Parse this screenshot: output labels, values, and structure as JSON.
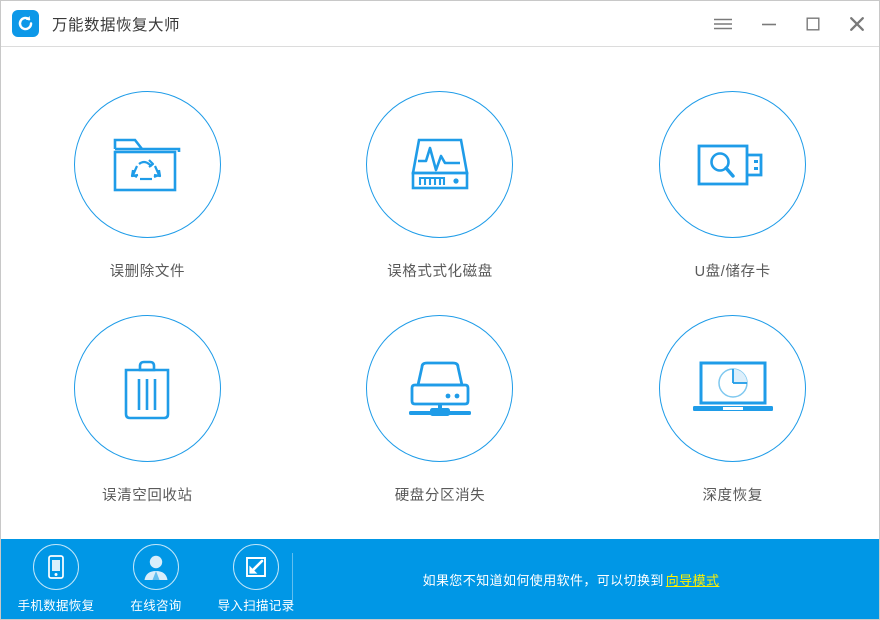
{
  "window": {
    "title": "万能数据恢复大师",
    "logo_icon": "refresh-circle-logo-icon",
    "accent_color": "#1f9ce8",
    "bottom_bar_color": "#0097e6",
    "controls": [
      {
        "name": "menu-button",
        "icon": "hamburger-menu-icon",
        "label": ""
      },
      {
        "name": "minimize-button",
        "icon": "minimize-icon",
        "label": ""
      },
      {
        "name": "maximize-button",
        "icon": "maximize-icon",
        "label": ""
      },
      {
        "name": "close-button",
        "icon": "close-icon",
        "label": ""
      }
    ]
  },
  "main": {
    "cards": [
      {
        "label": "误删除文件",
        "icon": "folder-recycle-icon"
      },
      {
        "label": "误格式式化磁盘",
        "icon": "disk-pulse-icon"
      },
      {
        "label": "U盘/储存卡",
        "icon": "usb-search-icon"
      },
      {
        "label": "误清空回收站",
        "icon": "trash-bin-icon"
      },
      {
        "label": "硬盘分区消失",
        "icon": "external-drive-icon"
      },
      {
        "label": "深度恢复",
        "icon": "laptop-pie-icon"
      }
    ]
  },
  "bottom": {
    "actions": [
      {
        "label": "手机数据恢复",
        "icon": "mobile-phone-icon"
      },
      {
        "label": "在线咨询",
        "icon": "user-support-icon"
      },
      {
        "label": "导入扫描记录",
        "icon": "import-arrow-icon"
      }
    ],
    "hint_text": "如果您不知道如何使用软件，可以切换到",
    "hint_link": "向导模式",
    "hint_link_color": "#fff000"
  }
}
